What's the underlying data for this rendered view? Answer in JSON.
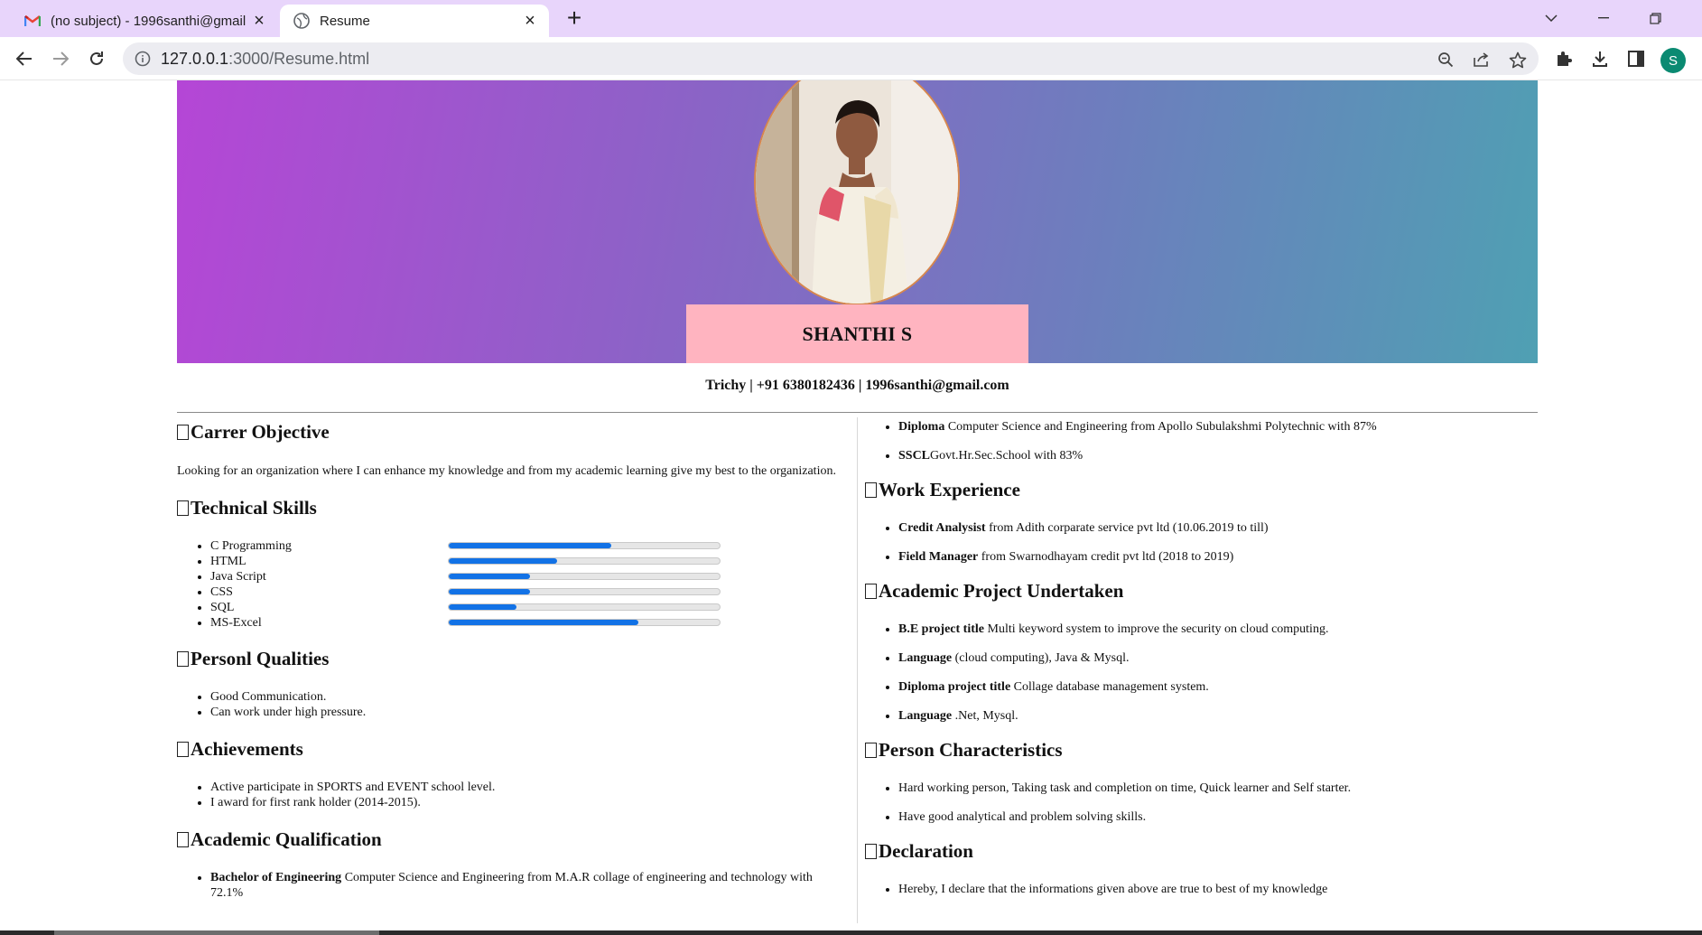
{
  "browser": {
    "tabs": [
      {
        "title": "(no subject) - 1996santhi@gmail",
        "icon": "gmail-icon"
      },
      {
        "title": "Resume",
        "icon": "globe-icon"
      }
    ],
    "url_host": "127.0.0.1",
    "url_path": ":3000/Resume.html",
    "profile_initial": "S"
  },
  "resume": {
    "name": "SHANTHI S",
    "contact": "Trichy | +91 6380182436 | 1996santhi@gmail.com",
    "objective": {
      "heading": "Carrer Objective",
      "text": "Looking for an organization where I can enhance my knowledge and from my academic learning give my best to the organization."
    },
    "skills": {
      "heading": "Technical Skills",
      "items": [
        {
          "name": "C Programming",
          "level": 0.6
        },
        {
          "name": "HTML",
          "level": 0.4
        },
        {
          "name": "Java Script",
          "level": 0.3
        },
        {
          "name": "CSS",
          "level": 0.3
        },
        {
          "name": "SQL",
          "level": 0.25
        },
        {
          "name": "MS-Excel",
          "level": 0.7
        }
      ]
    },
    "qualities": {
      "heading": "Personl Qualities",
      "items": [
        "Good Communication.",
        "Can work under high pressure."
      ]
    },
    "achievements": {
      "heading": "Achievements",
      "items": [
        "Active participate in SPORTS and EVENT school level.",
        "I award for first rank holder (2014-2015)."
      ]
    },
    "academic": {
      "heading": "Academic Qualification",
      "items": [
        {
          "label": "Bachelor of Engineering",
          "text": " Computer Science and Engineering from M.A.R collage of engineering and technology with 72.1%"
        }
      ]
    },
    "academic_cont": {
      "items": [
        {
          "label": "Diploma",
          "text": " Computer Science and Engineering from Apollo Subulakshmi Polytechnic with 87%"
        },
        {
          "label": "SSCL",
          "text": "Govt.Hr.Sec.School with 83%"
        }
      ]
    },
    "work": {
      "heading": "Work Experience",
      "items": [
        {
          "label": "Credit Analysist",
          "text": " from Adith corparate service pvt ltd (10.06.2019 to till)"
        },
        {
          "label": "Field Manager",
          "text": " from Swarnodhayam credit pvt ltd (2018 to 2019)"
        }
      ]
    },
    "project": {
      "heading": "Academic Project Undertaken",
      "items": [
        {
          "label": "B.E project title",
          "text": " Multi keyword system to improve the security on cloud computing."
        },
        {
          "label": "Language",
          "text": " (cloud computing), Java & Mysql."
        },
        {
          "label": "Diploma project title",
          "text": " Collage database management system."
        },
        {
          "label": "Language",
          "text": " .Net, Mysql."
        }
      ]
    },
    "characteristics": {
      "heading": "Person Characteristics",
      "items": [
        "Hard working person, Taking task and completion on time, Quick learner and Self starter.",
        "Have good analytical and problem solving skills."
      ]
    },
    "declaration": {
      "heading": "Declaration",
      "items": [
        "Hereby, I declare that the informations given above are true to best of my knowledge"
      ]
    }
  }
}
